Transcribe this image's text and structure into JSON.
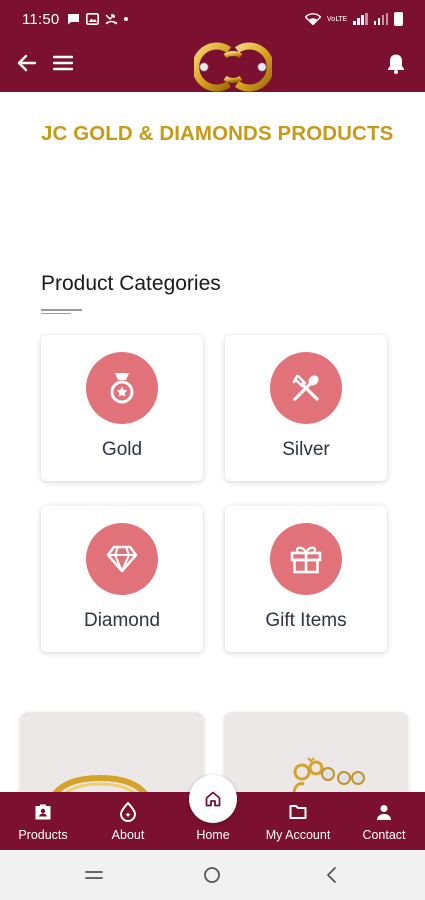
{
  "status_bar": {
    "time": "11:50",
    "network_label": "VoLTE",
    "icons": [
      "chat-icon",
      "gallery-icon",
      "missed-call-icon",
      "wifi-icon",
      "signal-icon",
      "battery-icon"
    ]
  },
  "app_bar": {
    "icons": [
      "back-arrow-icon",
      "hamburger-menu-icon",
      "brand-logo",
      "bell-icon"
    ]
  },
  "page": {
    "title": "JC GOLD & DIAMONDS PRODUCTS"
  },
  "categories": {
    "heading": "Product Categories",
    "items": [
      {
        "label": "Gold",
        "icon": "medal-icon"
      },
      {
        "label": "Silver",
        "icon": "cutlery-icon"
      },
      {
        "label": "Diamond",
        "icon": "diamond-icon"
      },
      {
        "label": "Gift Items",
        "icon": "gift-icon"
      }
    ]
  },
  "bottom_nav": {
    "items": [
      {
        "label": "Products",
        "icon": "products-icon"
      },
      {
        "label": "About",
        "icon": "about-icon"
      },
      {
        "label": "Home",
        "icon": "home-icon",
        "active": true
      },
      {
        "label": "My Account",
        "icon": "folder-icon"
      },
      {
        "label": "Contact",
        "icon": "person-icon"
      }
    ]
  },
  "colors": {
    "brand": "#7b1031",
    "gold_title": "#c79a17",
    "category_circle": "#e2727a",
    "category_label": "#2e3440"
  }
}
